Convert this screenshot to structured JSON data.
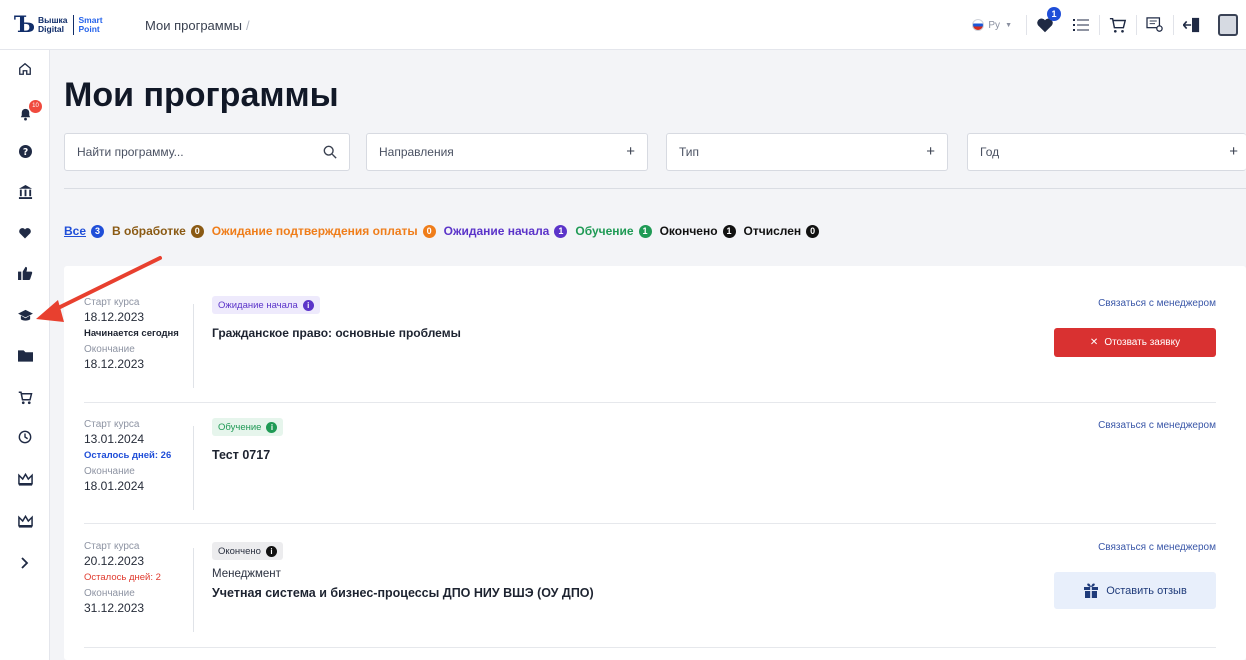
{
  "header": {
    "logo_line1": "Вышка",
    "logo_line2": "Digital",
    "logo_line3": "Smart",
    "logo_line4": "Point",
    "breadcrumb": "Мои программы",
    "breadcrumb_sep": "/",
    "lang": "Ру",
    "favorites_count": "1"
  },
  "sidebar": {
    "notifications_count": "10"
  },
  "page": {
    "title": "Мои программы"
  },
  "filters": {
    "search_placeholder": "Найти программу...",
    "directions": "Направления",
    "type": "Тип",
    "year": "Год"
  },
  "tabs": [
    {
      "label": "Все",
      "count": "3",
      "color": "#1f4ed8"
    },
    {
      "label": "В обработке",
      "count": "0",
      "color": "#8a5a14"
    },
    {
      "label": "Ожидание подтверждения оплаты",
      "count": "0",
      "color": "#ef7d1a"
    },
    {
      "label": "Ожидание начала",
      "count": "1",
      "color": "#5b34c9"
    },
    {
      "label": "Обучение",
      "count": "1",
      "color": "#1f9a55"
    },
    {
      "label": "Окончено",
      "count": "1",
      "color": "#111111"
    },
    {
      "label": "Отчислен",
      "count": "0",
      "color": "#111111"
    }
  ],
  "programs": [
    {
      "start_label": "Старт курса",
      "start_date": "18.12.2023",
      "note": "Начинается сегодня",
      "end_label": "Окончание",
      "end_date": "18.12.2023",
      "status": "Ожидание начала",
      "subtitle": "",
      "title": "Гражданское право: основные проблемы",
      "contact": "Связаться с менеджером",
      "action": "Отозвать заявку"
    },
    {
      "start_label": "Старт курса",
      "start_date": "13.01.2024",
      "note": "Осталось дней: 26",
      "end_label": "Окончание",
      "end_date": "18.01.2024",
      "status": "Обучение",
      "subtitle": "",
      "title": "Тест 0717",
      "contact": "Связаться с менеджером",
      "action": ""
    },
    {
      "start_label": "Старт курса",
      "start_date": "20.12.2023",
      "note": "Осталось дней: 2",
      "end_label": "Окончание",
      "end_date": "31.12.2023",
      "status": "Окончено",
      "subtitle": "Менеджмент",
      "title": "Учетная система и бизнес-процессы ДПО НИУ ВШЭ (ОУ ДПО)",
      "contact": "Связаться с менеджером",
      "action": "Оставить отзыв"
    }
  ],
  "colors": {
    "brand": "#102d69",
    "accent": "#2563eb",
    "danger": "#d93131",
    "arrow": "#e8402f"
  }
}
